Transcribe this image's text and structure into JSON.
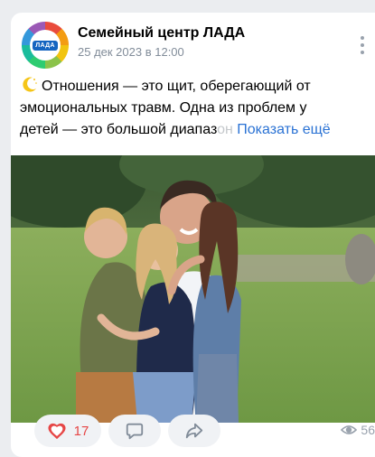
{
  "post": {
    "community_name": "Семейный центр ЛАДА",
    "logo_text": "ЛАДА",
    "date": "25 дек 2023 в 12:00",
    "text_line1": "Отношения — это щит, оберегающий от",
    "text_line2": "эмоциональных травм. Одна из проблем у",
    "text_line3_start": "детей — это большой диапаз",
    "text_line3_fade": "он",
    "show_more_label": "Показать ещё",
    "emoji_icon": "crescent-moon-icon"
  },
  "actions": {
    "likes_count": "17",
    "views_count": "56",
    "like_color": "#e64646",
    "accent_color": "#2a72d4"
  }
}
